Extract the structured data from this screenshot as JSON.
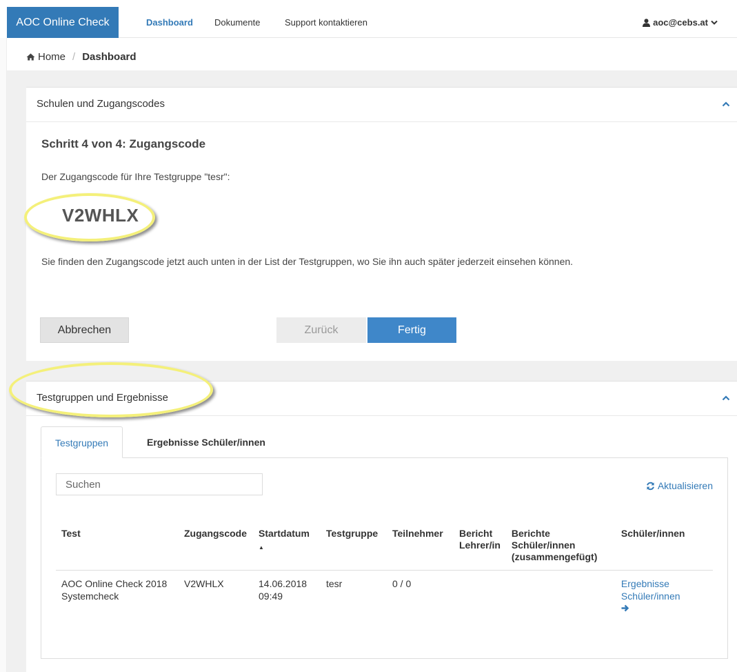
{
  "navbar": {
    "brand": "AOC Online Check",
    "links": [
      "Dashboard",
      "Dokumente",
      "Support kontaktieren"
    ],
    "user": "aoc@cebs.at"
  },
  "breadcrumb": {
    "home": "Home",
    "separator": "/",
    "current": "Dashboard"
  },
  "wizard": {
    "panel_title": "Schulen und Zugangscodes",
    "step_title": "Schritt 4 von 4: Zugangscode",
    "code_label": "Der Zugangscode für Ihre Testgruppe \"tesr\":",
    "code": "V2WHLX",
    "hint": "Sie finden den Zugangscode jetzt auch unten in der List der Testgruppen, wo Sie ihn auch später jederzeit einsehen können.",
    "buttons": {
      "cancel": "Abbrechen",
      "back": "Zurück",
      "done": "Fertig"
    }
  },
  "groups": {
    "panel_title": "Testgruppen und Ergebnisse",
    "tabs": [
      "Testgruppen",
      "Ergebnisse Schüler/innen"
    ],
    "search_placeholder": "Suchen",
    "refresh": "Aktualisieren",
    "columns": {
      "test": "Test",
      "code": "Zugangscode",
      "start": "Startdatum",
      "group": "Testgruppe",
      "participants": "Teilnehmer",
      "teacher_report_1": "Bericht",
      "teacher_report_2": "Lehrer/in",
      "student_reports_1": "Berichte",
      "student_reports_2": "Schüler/innen",
      "student_reports_3": "(zusammengefügt)",
      "students": "Schüler/innen"
    },
    "rows": [
      {
        "test_1": "AOC Online Check 2018",
        "test_2": "Systemcheck",
        "code": "V2WHLX",
        "date": "14.06.2018",
        "time": "09:49",
        "group": "tesr",
        "participants": "0 / 0",
        "results_1": "Ergebnisse",
        "results_2": "Schüler/innen"
      }
    ]
  },
  "colors": {
    "primary": "#337ab7",
    "highlight": "#f4f07a"
  }
}
